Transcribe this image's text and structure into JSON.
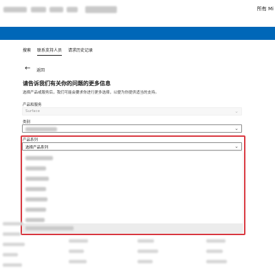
{
  "header": {
    "right_text": "所有 Mi",
    "band_color": "#0067b8"
  },
  "tabs": [
    {
      "label": "搜索",
      "active": false
    },
    {
      "label": "联系支持人员",
      "active": true
    },
    {
      "label": "请求历史记录",
      "active": false
    }
  ],
  "back": {
    "label": "返回",
    "icon": "arrow-left-icon"
  },
  "form": {
    "heading": "请告诉我们有关你的问题的更多信息",
    "description": "选择产品或服务后，我们可能会要求你进行更多选择，以便为你提供适当的支持。",
    "product_label": "产品和服务",
    "product_value": "Surface",
    "category_label": "类别",
    "series_label": "产品系列",
    "series_placeholder": "选择产品系列"
  },
  "colors": {
    "highlight": "#d9363e",
    "hover_row": "#ececec"
  }
}
